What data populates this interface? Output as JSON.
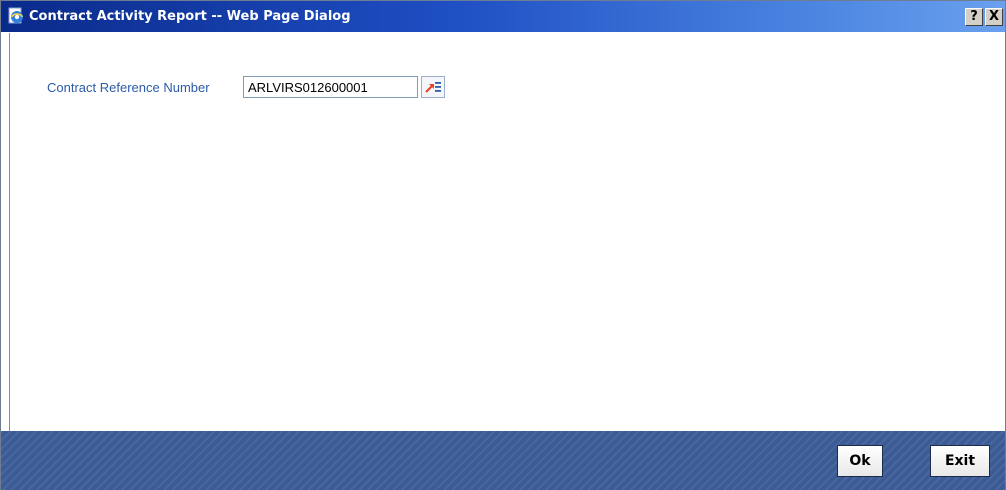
{
  "window": {
    "title": "Contract Activity Report -- Web Page Dialog",
    "help_label": "?",
    "close_label": "X"
  },
  "form": {
    "contract_reference_label": "Contract Reference Number",
    "contract_reference_value": "ARLVIRS012600001"
  },
  "footer": {
    "ok_label": "Ok",
    "exit_label": "Exit"
  },
  "icons": {
    "title": "ie-page-icon",
    "lov": "list-of-values-icon"
  },
  "colors": {
    "label": "#2c5ba8",
    "footer": "#3b5b96",
    "lov_arrow": "#e8421c"
  }
}
